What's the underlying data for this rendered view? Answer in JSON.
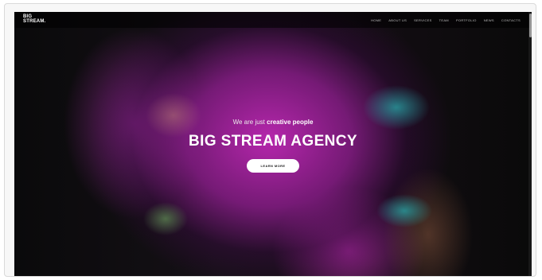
{
  "navbar": {
    "logo_line1": "BIG",
    "logo_line2": "STREAM.",
    "menu": [
      {
        "label": "HOME"
      },
      {
        "label": "ABOUT US"
      },
      {
        "label": "SERVICES"
      },
      {
        "label": "TEAM"
      },
      {
        "label": "PORTFOLIO"
      },
      {
        "label": "NEWS"
      },
      {
        "label": "CONTACTS"
      }
    ]
  },
  "hero": {
    "tagline_prefix": "We are just ",
    "tagline_emphasis": "creative people",
    "headline": "BIG STREAM AGENCY",
    "cta_label": "LEARN MORE"
  },
  "colors": {
    "magenta_powder": "#be28b4",
    "teal_fingertips": "#28aaaa",
    "background": "#0b0b0c",
    "cta_background": "#ffffff"
  }
}
